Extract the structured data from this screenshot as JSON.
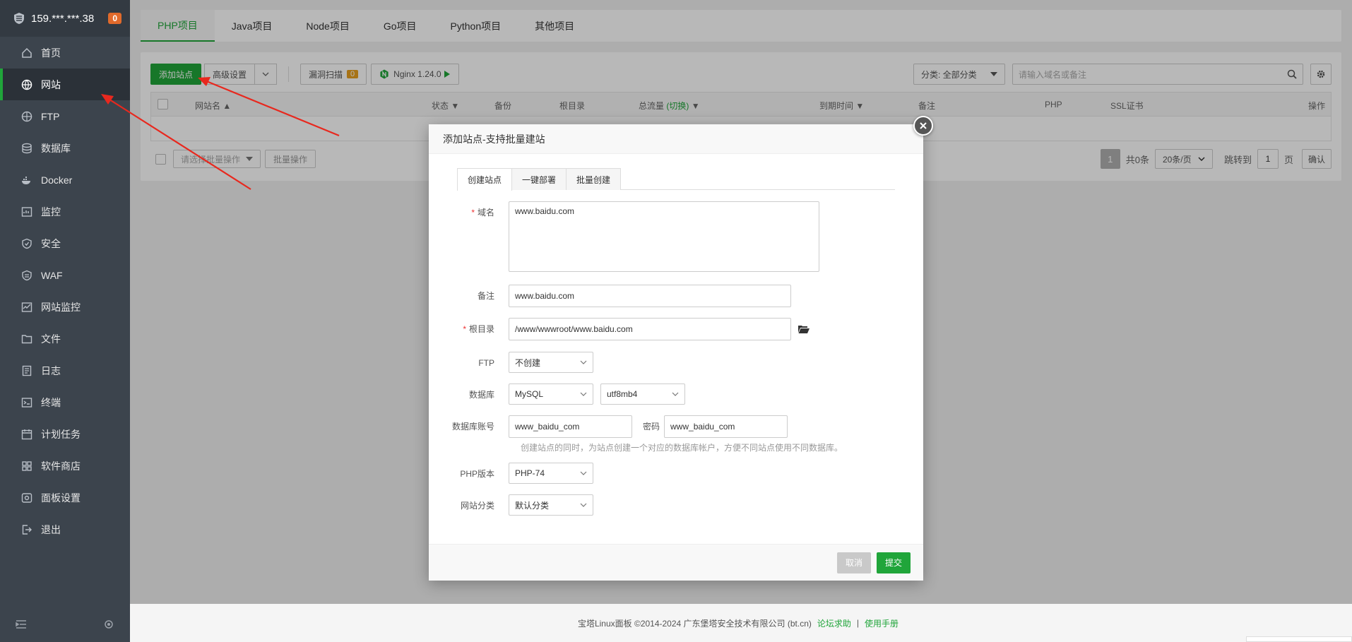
{
  "server": {
    "ip": "159.***.***.38",
    "badge": "0"
  },
  "sidebar": {
    "items": [
      {
        "label": "首页",
        "icon": "home-icon"
      },
      {
        "label": "网站",
        "icon": "globe-icon",
        "active": true
      },
      {
        "label": "FTP",
        "icon": "ftp-icon"
      },
      {
        "label": "数据库",
        "icon": "database-icon"
      },
      {
        "label": "Docker",
        "icon": "docker-icon"
      },
      {
        "label": "监控",
        "icon": "monitor-icon"
      },
      {
        "label": "安全",
        "icon": "shield-icon"
      },
      {
        "label": "WAF",
        "icon": "waf-icon"
      },
      {
        "label": "网站监控",
        "icon": "site-monitor-icon"
      },
      {
        "label": "文件",
        "icon": "folder-icon"
      },
      {
        "label": "日志",
        "icon": "log-icon"
      },
      {
        "label": "终端",
        "icon": "terminal-icon"
      },
      {
        "label": "计划任务",
        "icon": "cron-icon"
      },
      {
        "label": "软件商店",
        "icon": "store-icon"
      },
      {
        "label": "面板设置",
        "icon": "settings-icon"
      },
      {
        "label": "退出",
        "icon": "logout-icon"
      }
    ]
  },
  "project_tabs": [
    "PHP项目",
    "Java项目",
    "Node项目",
    "Go项目",
    "Python项目",
    "其他项目"
  ],
  "toolbar": {
    "add_site": "添加站点",
    "advanced": "高级设置",
    "vuln_scan": "漏洞扫描",
    "vuln_count": "0",
    "nginx": "Nginx 1.24.0",
    "category": "分类: 全部分类",
    "search_placeholder": "请输入域名或备注"
  },
  "table": {
    "headers": [
      "网站名",
      "状态",
      "备份",
      "根目录",
      "总流量",
      "(切换)",
      "到期时间",
      "备注",
      "PHP",
      "SSL证书",
      "操作"
    ]
  },
  "pager": {
    "batch_select": "请选择批量操作",
    "batch_btn": "批量操作",
    "current": "1",
    "total": "共0条",
    "per_page": "20条/页",
    "goto": "跳转到",
    "goto_page": "1",
    "page_unit": "页",
    "confirm": "确认"
  },
  "footer": {
    "copyright": "宝塔Linux面板 ©2014-2024 广东堡塔安全技术有限公司 (bt.cn)",
    "forum": "论坛求助",
    "sep": "|",
    "manual": "使用手册"
  },
  "modal": {
    "title": "添加站点-支持批量建站",
    "tabs": [
      "创建站点",
      "一键部署",
      "批量创建"
    ],
    "domain_label": "域名",
    "domain_value": "www.baidu.com",
    "remark_label": "备注",
    "remark_value": "www.baidu.com",
    "root_label": "根目录",
    "root_value": "/www/wwwroot/www.baidu.com",
    "ftp_label": "FTP",
    "ftp_value": "不创建",
    "db_label": "数据库",
    "db_type": "MySQL",
    "db_charset": "utf8mb4",
    "db_user_label": "数据库账号",
    "db_user": "www_baidu_com",
    "db_pass_label": "密码",
    "db_pass": "www_baidu_com",
    "db_hint": "创建站点的同时，为站点创建一个对应的数据库帐户，方便不同站点使用不同数据库。",
    "php_label": "PHP版本",
    "php_value": "PHP-74",
    "category_label": "网站分类",
    "category_value": "默认分类",
    "cancel": "取消",
    "submit": "提交"
  },
  "colors": {
    "accent": "#20a53a",
    "sidebar": "#3c444d",
    "badge": "#e16a2b",
    "arrow": "#e8281e"
  }
}
